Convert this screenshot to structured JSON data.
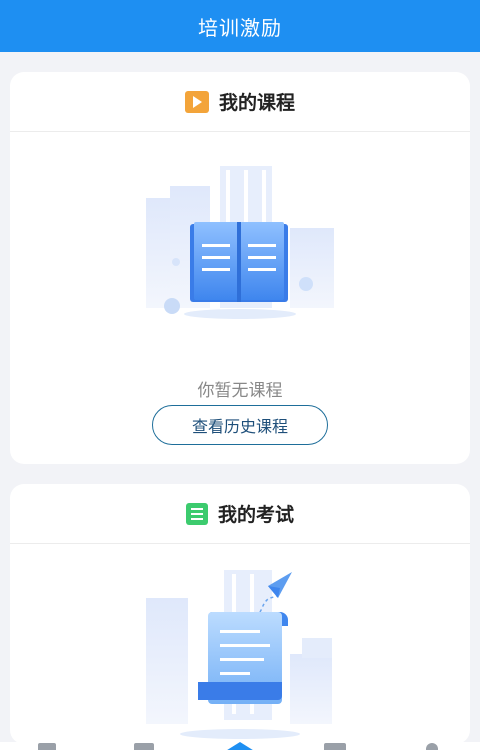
{
  "header": {
    "title": "培训激励"
  },
  "course": {
    "title": "我的课程",
    "empty_text": "你暂无课程",
    "history_button": "查看历史课程",
    "icon": "play-square-icon"
  },
  "exam": {
    "title": "我的考试",
    "icon": "exam-list-icon"
  },
  "colors": {
    "primary": "#1e8ff2",
    "course_icon": "#f3a43a",
    "exam_icon": "#3ccb6e",
    "button_border": "#1e6e9a"
  },
  "tabbar": {
    "icons": [
      "tab-1-icon",
      "tab-2-icon",
      "tab-home-icon",
      "tab-4-icon",
      "tab-profile-icon"
    ]
  }
}
